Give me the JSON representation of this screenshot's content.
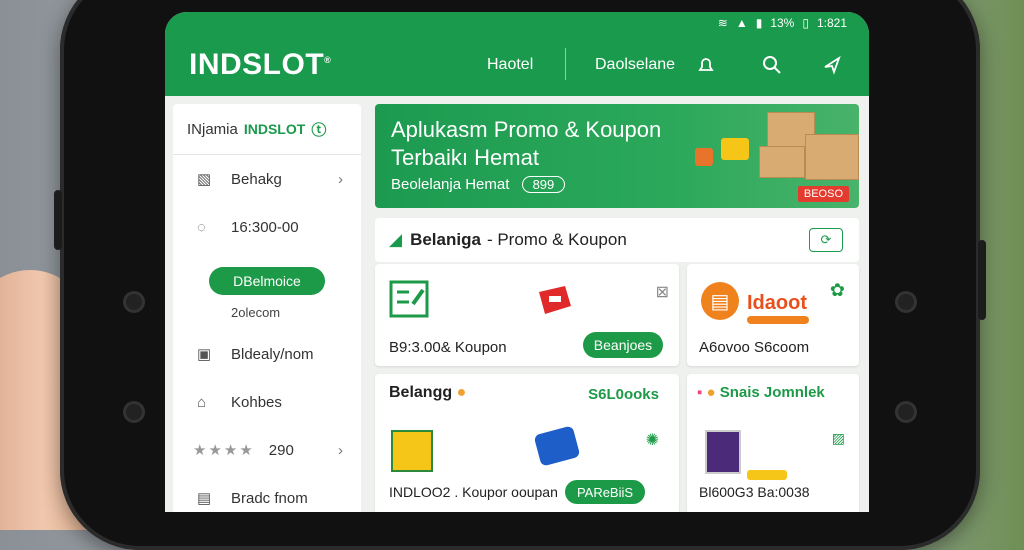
{
  "status": {
    "signal": "▲",
    "battery_pct": "13%",
    "time": "1:821"
  },
  "header": {
    "logo": "INDSLOT",
    "nav1": "Haotel",
    "nav2": "Daolselane"
  },
  "sidebar": {
    "brand_prefix": "INjamia",
    "brand": "INDSLOT",
    "items": [
      {
        "label": "Behakg"
      },
      {
        "label": "16:300-00"
      }
    ],
    "pill": "DBelmoice",
    "pill_sub": "2olecom",
    "items2": [
      {
        "label": "Bldealy/nom"
      },
      {
        "label": "Kohbes"
      }
    ],
    "rating_value": "290",
    "last_item": "Bradc fnom"
  },
  "banner": {
    "title_line1": "Aplukasm Promo & Koupon",
    "title_line2": "Terbaikı Hemat",
    "subtitle": "Beolelanja Hemat",
    "code": "899",
    "tag": "BEOSO"
  },
  "section": {
    "title_bold": "Belaniga",
    "title_rest": "- Promo & Koupon"
  },
  "cards": {
    "c1_label": "B9:3.00& Koupon",
    "c1_button": "Beanjoes",
    "c2_brand": "Idaoot",
    "c2_label": "A6ovoo S6coom",
    "c3_title": "Belangg",
    "c3_right": "S6L0ooks",
    "c3_label": "INDLOO2 . Koupor ooupan",
    "c3_button": "PAReBiiS",
    "c4_title": "Snais Jomnlek",
    "c4_label": "Bl600G3 Ba:0038"
  }
}
